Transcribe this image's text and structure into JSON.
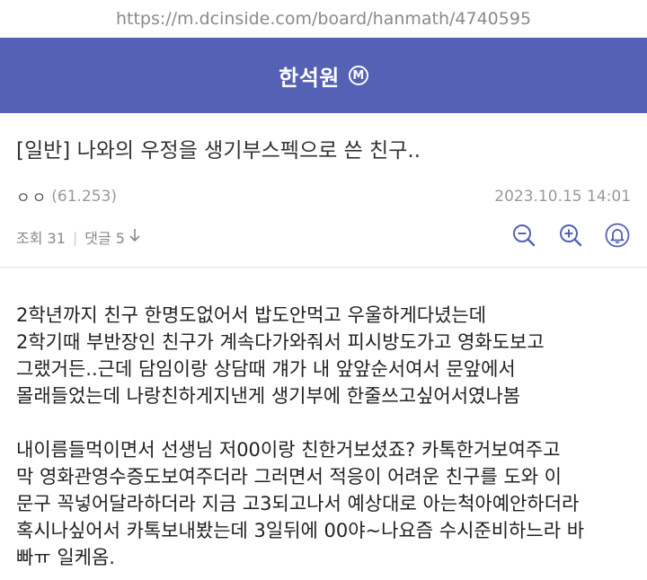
{
  "url": "https://m.dcinside.com/board/hanmath/4740595",
  "header": {
    "gallery_title": "한석원",
    "manager_badge": "M"
  },
  "post": {
    "title": "[일반] 나와의 우정을 생기부스펙으로 쓴 친구..",
    "author_name": "ㅇㅇ",
    "author_ip": "(61.253)",
    "date": "2023.10.15 14:01",
    "views_label": "조회 31",
    "comments_label": "댓글 5",
    "body_lines": [
      [
        "2학년까지 친구 한명도없어서 밥도안먹고 우울하게다녔는데",
        "2학기때 부반장인 친구가 계속다가와줘서 피시방도가고 영화도보고",
        "그랬거든..근데 담임이랑 상담때 걔가 내 앞앞순서여서 문앞에서",
        "몰래들었는데 나랑친하게지낸게 생기부에 한줄쓰고싶어서였나봄"
      ],
      [
        "내이름들먹이면서 선생님 저00이랑 친한거보셨죠? 카톡한거보여주고",
        "막 영화관영수증도보여주더라 그러면서 적응이 어려운 친구를 도와 이",
        "문구 꼭넣어달라하더라 지금 고3되고나서 예상대로 아는척아예안하더라",
        "혹시나싶어서 카톡보내봤는데 3일뒤에 00야~나요즘 수시준비하느라 바",
        "빠ㅠ 일케옴."
      ]
    ]
  },
  "icons": {
    "zoom_out": "zoom-out-icon",
    "zoom_in": "zoom-in-icon",
    "notify": "bell-icon",
    "comments_arrow": "arrow-down-icon"
  },
  "colors": {
    "header_bg": "#5461b4",
    "icon_color": "#5461b4"
  }
}
